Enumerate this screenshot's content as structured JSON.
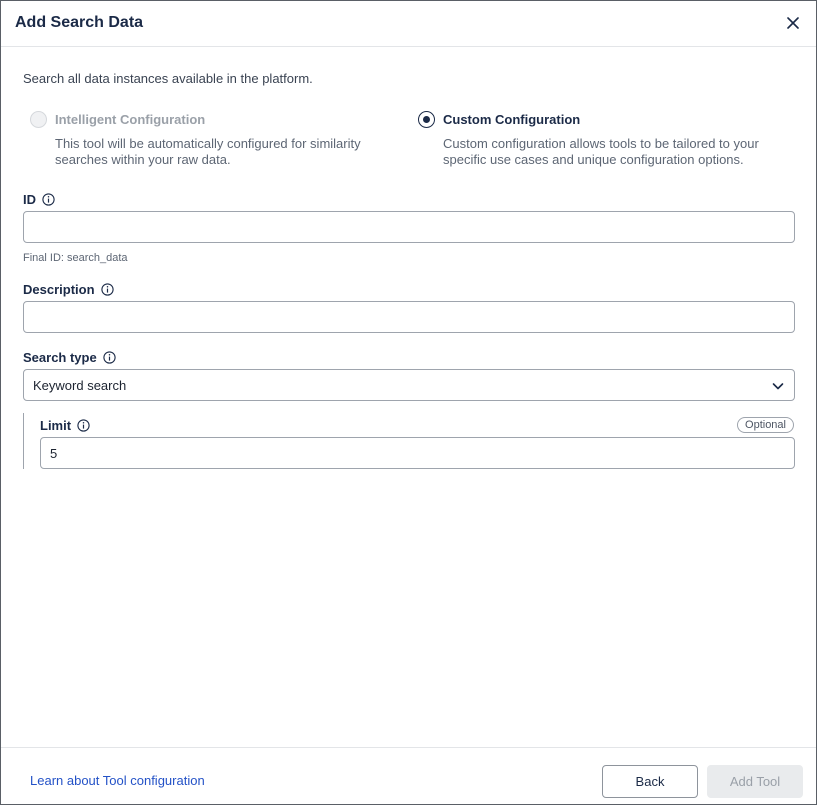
{
  "dialog": {
    "title": "Add Search Data",
    "intro": "Search all data instances available in the platform."
  },
  "config_options": [
    {
      "label": "Intelligent Configuration",
      "description": "This tool will be automatically configured for similarity searches within your raw data.",
      "state": "disabled"
    },
    {
      "label": "Custom Configuration",
      "description": "Custom configuration allows tools to be tailored to your specific use cases and unique configuration options.",
      "state": "selected"
    }
  ],
  "fields": {
    "id": {
      "label": "ID",
      "value": "",
      "placeholder": "",
      "helper": "Final ID: search_data"
    },
    "description": {
      "label": "Description",
      "value": "",
      "placeholder": ""
    },
    "search_type": {
      "label": "Search type",
      "value": "Keyword search"
    },
    "limit": {
      "label": "Limit",
      "badge": "Optional",
      "value": "5"
    }
  },
  "footer": {
    "learn_link": "Learn about Tool configuration",
    "back_label": "Back",
    "add_label": "Add Tool"
  },
  "icons": {
    "close": "close-icon",
    "info": "info-icon",
    "chevron": "chevron-down-icon"
  },
  "colors": {
    "title": "#1b2a47",
    "link": "#2452c7",
    "disabled_button_bg": "#e9ebed"
  }
}
